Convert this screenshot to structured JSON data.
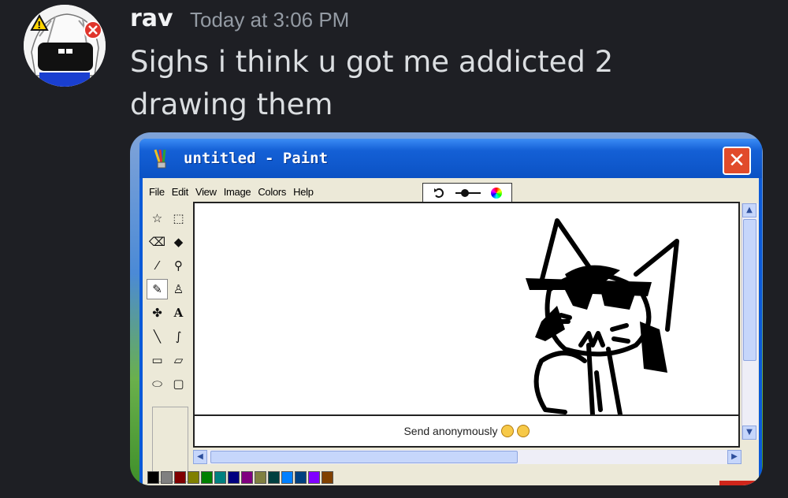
{
  "message": {
    "username": "rav",
    "timestamp": "Today at 3:06 PM",
    "text": "Sighs i think u got me addicted 2 drawing them"
  },
  "paint": {
    "title": "untitled - Paint",
    "close_label": "✕",
    "menu": [
      "File",
      "Edit",
      "View",
      "Image",
      "Colors",
      "Help"
    ],
    "send_label": "Send anonymously",
    "palette": [
      "#000000",
      "#808080",
      "#800000",
      "#808000",
      "#008000",
      "#008080",
      "#000080",
      "#800080",
      "#808040",
      "#004040",
      "#0080ff",
      "#004080",
      "#8000ff",
      "#804000"
    ]
  }
}
